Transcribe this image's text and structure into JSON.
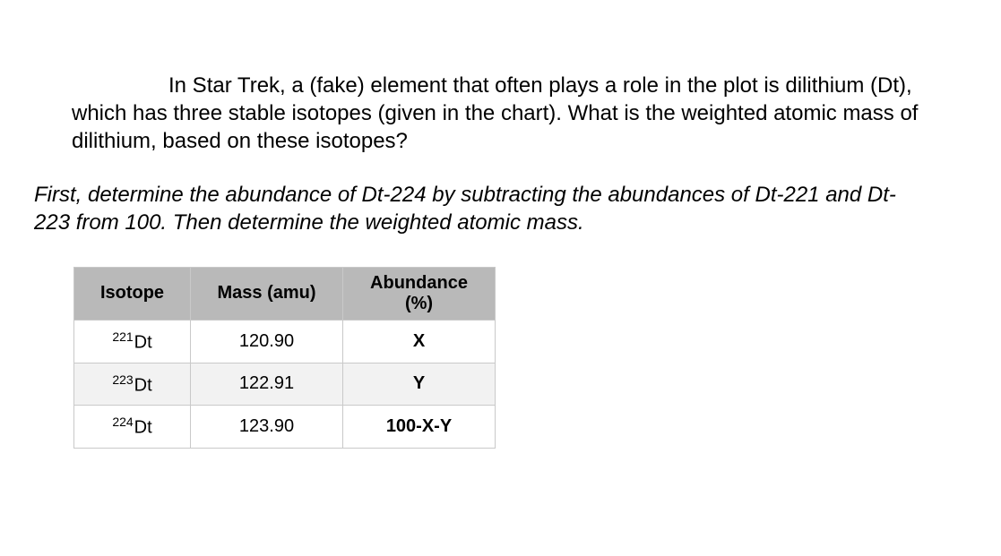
{
  "question": {
    "text": "In Star Trek, a (fake) element that often plays a role in the plot is dilithium (Dt), which has three stable isotopes (given in the chart). What is the weighted atomic mass of dilithium, based on these isotopes?"
  },
  "instruction": {
    "text": "First, determine the abundance of Dt-224 by subtracting the abundances of Dt-221 and Dt-223 from 100. Then determine the weighted atomic mass."
  },
  "table": {
    "headers": {
      "isotope": "Isotope",
      "mass": "Mass (amu)",
      "abundance_line1": "Abundance",
      "abundance_line2": "(%)"
    },
    "rows": [
      {
        "iso_sup": "221",
        "iso_sym": "Dt",
        "mass": "120.90",
        "abundance": "X"
      },
      {
        "iso_sup": "223",
        "iso_sym": "Dt",
        "mass": "122.91",
        "abundance": "Y"
      },
      {
        "iso_sup": "224",
        "iso_sym": "Dt",
        "mass": "123.90",
        "abundance": "100-X-Y"
      }
    ]
  }
}
